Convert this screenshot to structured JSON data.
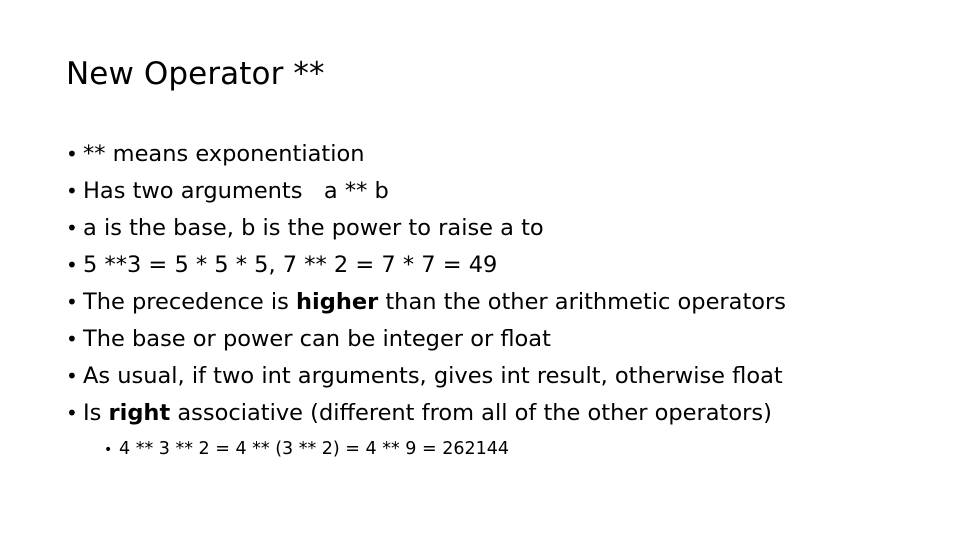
{
  "slide": {
    "title": "New Operator **",
    "bullet_marker": "•",
    "bullets": [
      {
        "text": "** means exponentiation"
      },
      {
        "text": "Has two arguments   a ** b"
      },
      {
        "text": "a is the base, b is the power to raise a to"
      },
      {
        "text": "5 **3 = 5 * 5 * 5, 7 ** 2 = 7 * 7 = 49"
      },
      {
        "pre": "The precedence is ",
        "bold": "higher",
        "post": " than the other arithmetic operators"
      },
      {
        "text": "The base or power can be integer or float"
      },
      {
        "text": "As usual, if two int arguments, gives int result, otherwise float"
      },
      {
        "pre": "Is ",
        "bold": "right",
        "post": " associative (different from all of the other operators)"
      }
    ],
    "sub_bullets": [
      {
        "text": "4 ** 3 ** 2 = 4 ** (3 ** 2) = 4 ** 9 = 262144"
      }
    ],
    "colors": {
      "background": "#ffffff",
      "text": "#000000"
    }
  }
}
